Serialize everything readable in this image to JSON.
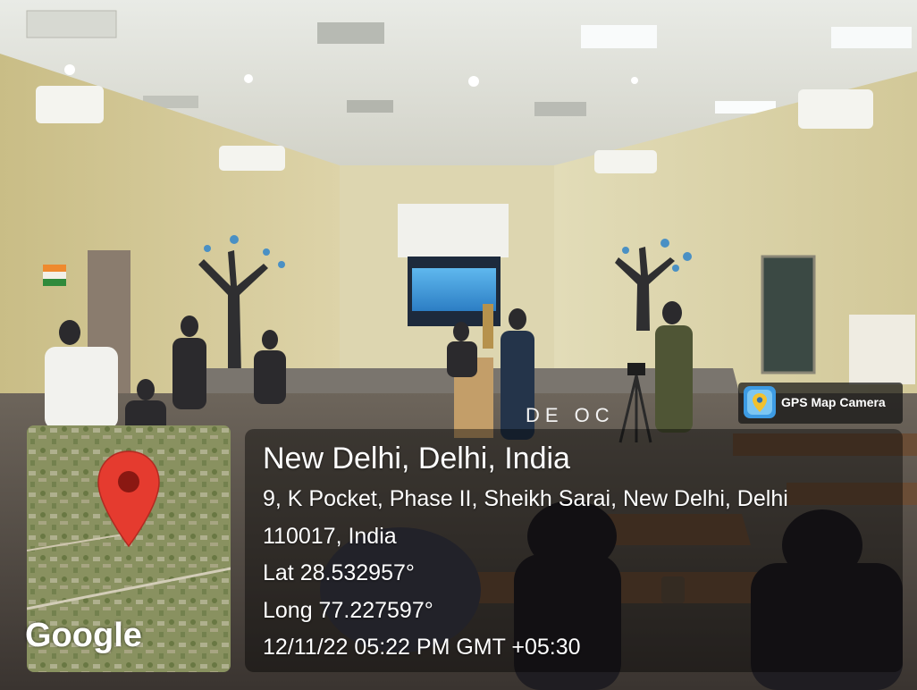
{
  "stamp": {
    "city": "New Delhi, Delhi, India",
    "address_line1": "9, K Pocket, Phase II, Sheikh Sarai, New Delhi, Delhi",
    "address_line2": "110017, India",
    "latitude": "Lat 28.532957°",
    "longitude": "Long 77.227597°",
    "timestamp": "12/11/22 05:22 PM GMT +05:30"
  },
  "map": {
    "provider_logo": "Google",
    "pin_icon": "map-pin-icon"
  },
  "app_badge": {
    "label": "GPS Map Camera",
    "icon": "gps-map-camera-icon"
  },
  "scene": {
    "stage_banner_fragment": "DE OC"
  },
  "colors": {
    "pin": "#e53b2f",
    "overlay": "#000000",
    "text": "#ffffff"
  }
}
